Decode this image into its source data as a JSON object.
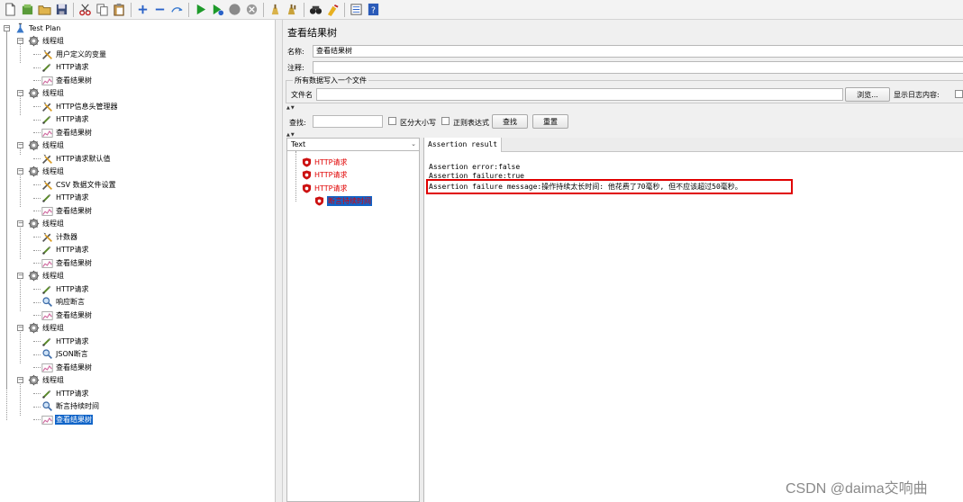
{
  "toolbar": {
    "icons": [
      "new-icon",
      "templates-icon",
      "open-icon",
      "save-icon",
      "cut-icon",
      "copy-icon",
      "paste-icon",
      "expand-icon",
      "collapse-icon",
      "toggle-icon",
      "start-icon",
      "start-no-pause-icon",
      "stop-icon",
      "shutdown-icon",
      "clear-icon",
      "clear-all-icon",
      "search-icon",
      "reset-search-icon",
      "function-helper-icon",
      "help-icon"
    ]
  },
  "tree": {
    "rows": [
      {
        "label": "Test Plan",
        "icon": "test-plan-icon"
      },
      {
        "label": "线程组",
        "icon": "thread-group-icon"
      },
      {
        "label": "用户定义的变量",
        "icon": "config-icon"
      },
      {
        "label": "HTTP请求",
        "icon": "sampler-icon"
      },
      {
        "label": "查看结果树",
        "icon": "listener-icon"
      },
      {
        "label": "线程组",
        "icon": "thread-group-icon"
      },
      {
        "label": "HTTP信息头管理器",
        "icon": "config-icon"
      },
      {
        "label": "HTTP请求",
        "icon": "sampler-icon"
      },
      {
        "label": "查看结果树",
        "icon": "listener-icon"
      },
      {
        "label": "线程组",
        "icon": "thread-group-icon"
      },
      {
        "label": "HTTP请求默认值",
        "icon": "config-icon"
      },
      {
        "label": "线程组",
        "icon": "thread-group-icon"
      },
      {
        "label": "CSV 数据文件设置",
        "icon": "config-icon"
      },
      {
        "label": "HTTP请求",
        "icon": "sampler-icon"
      },
      {
        "label": "查看结果树",
        "icon": "listener-icon"
      },
      {
        "label": "线程组",
        "icon": "thread-group-icon"
      },
      {
        "label": "计数器",
        "icon": "config-icon"
      },
      {
        "label": "HTTP请求",
        "icon": "sampler-icon"
      },
      {
        "label": "查看结果树",
        "icon": "listener-icon"
      },
      {
        "label": "线程组",
        "icon": "thread-group-icon"
      },
      {
        "label": "HTTP请求",
        "icon": "sampler-icon"
      },
      {
        "label": "响应断言",
        "icon": "assertion-icon"
      },
      {
        "label": "查看结果树",
        "icon": "listener-icon"
      },
      {
        "label": "线程组",
        "icon": "thread-group-icon"
      },
      {
        "label": "HTTP请求",
        "icon": "sampler-icon"
      },
      {
        "label": "JSON断言",
        "icon": "assertion-icon"
      },
      {
        "label": "查看结果树",
        "icon": "listener-icon"
      },
      {
        "label": "线程组",
        "icon": "thread-group-icon"
      },
      {
        "label": "HTTP请求",
        "icon": "sampler-icon"
      },
      {
        "label": "断言持续时间",
        "icon": "assertion-icon"
      },
      {
        "label": "查看结果树",
        "icon": "listener-icon"
      }
    ]
  },
  "panel": {
    "title": "查看结果树",
    "name_label": "名称:",
    "name_value": "查看结果树",
    "comment_label": "注释:",
    "comment_value": "",
    "file_group_title": "所有数据写入一个文件",
    "filename_label": "文件名",
    "filename_value": "",
    "browse_button": "浏览...",
    "log_content_label": "显示日志内容:"
  },
  "search": {
    "label": "查找:",
    "value": "",
    "case_sensitive_label": "区分大小写",
    "regex_label": "正则表达式",
    "find_button": "查找",
    "reset_button": "重置"
  },
  "results": {
    "renderer_selected": "Text",
    "items": [
      {
        "label": "HTTP请求",
        "status": "error"
      },
      {
        "label": "HTTP请求",
        "status": "error"
      },
      {
        "label": "HTTP请求",
        "status": "error"
      },
      {
        "label": "断言持续时间",
        "status": "error"
      }
    ]
  },
  "detail": {
    "tab_label": "Assertion result",
    "lines": [
      "Assertion error:false",
      "Assertion failure:true",
      "Assertion failure message:操作持续太长时间: 他花费了70毫秒, 但不应该超过50毫秒。"
    ]
  },
  "colors": {
    "error_red": "#e00000",
    "selection_blue": "#1064c8",
    "panel_bg": "#f0f0f0"
  },
  "watermark": "CSDN @daima交响曲"
}
